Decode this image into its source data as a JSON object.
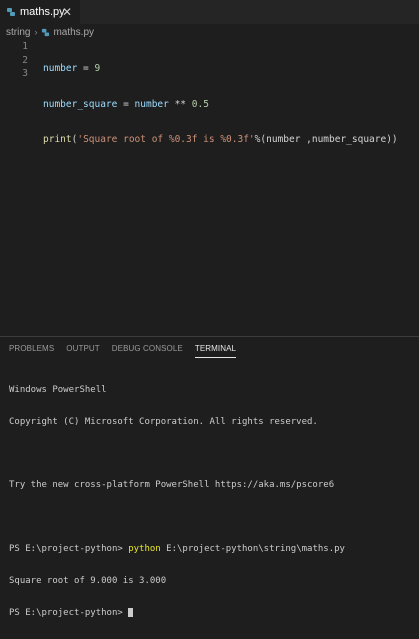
{
  "tab": {
    "filename": "maths.py",
    "close": "✕"
  },
  "breadcrumb": {
    "folder": "string",
    "file": "maths.py"
  },
  "editor": {
    "line_numbers": [
      "1",
      "2",
      "3"
    ],
    "line1": {
      "var": "number",
      "op": " = ",
      "num": "9"
    },
    "line2": {
      "var": "number_square",
      "op1": " = ",
      "var2": "number",
      "op2": " ** ",
      "num": "0.5"
    },
    "line3": {
      "fn": "print",
      "open": "(",
      "str": "'Square root of %0.3f is %0.3f'",
      "rest": "%(number ,number_square))"
    }
  },
  "panel": {
    "tabs": [
      "PROBLEMS",
      "OUTPUT",
      "DEBUG CONSOLE",
      "TERMINAL"
    ]
  },
  "terminal": {
    "l1": "Windows PowerShell",
    "l2": "Copyright (C) Microsoft Corporation. All rights reserved.",
    "l3": "",
    "l4": "Try the new cross-platform PowerShell https://aka.ms/pscore6",
    "l5": "",
    "l6_prompt": "PS E:\\project-python> ",
    "l6_cmd": "python",
    "l6_arg": " E:\\project-python\\string\\maths.py",
    "l7": "Square root of 9.000 is 3.000",
    "l8": "PS E:\\project-python> "
  },
  "colors": {
    "python_icon": "#519aba",
    "accent": "#e7e7e7"
  }
}
